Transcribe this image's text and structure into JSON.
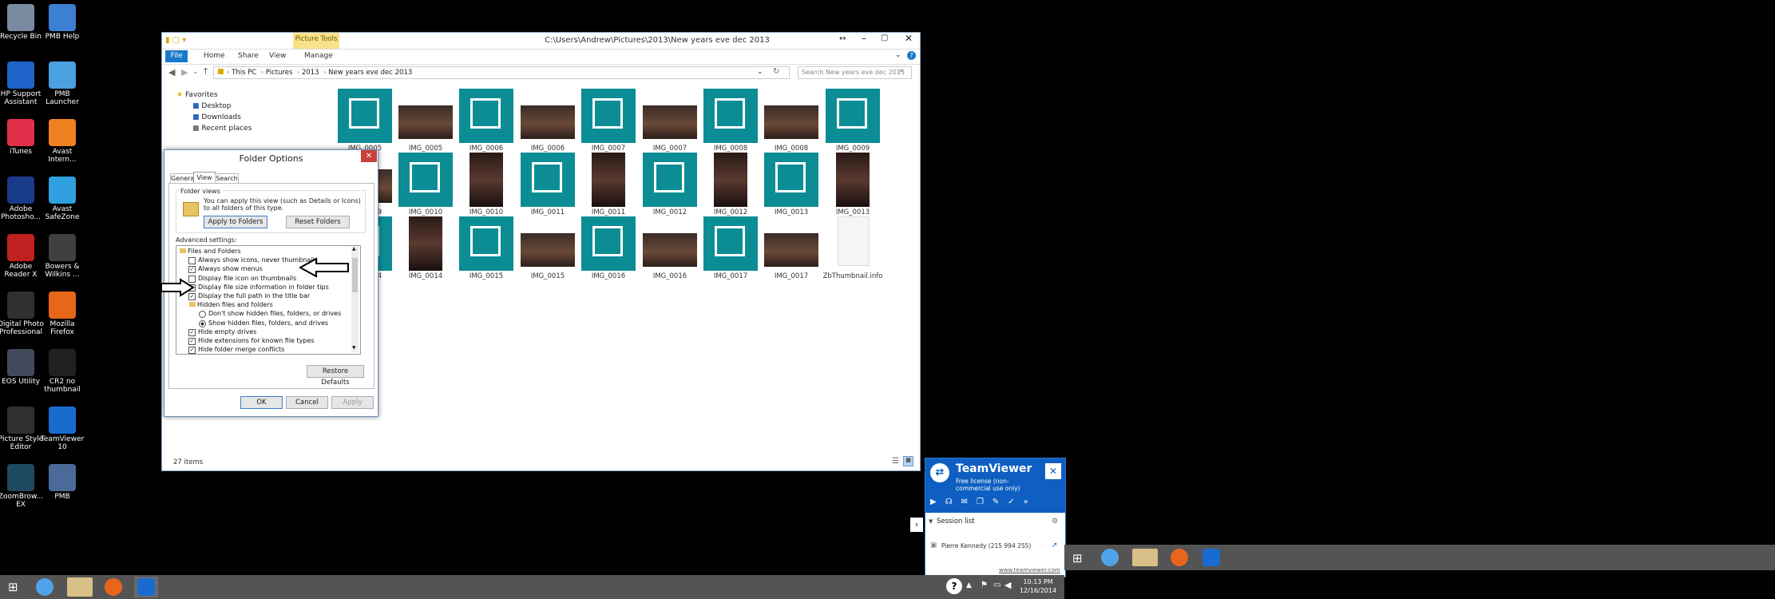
{
  "desktop_icons": [
    {
      "label": "Recycle Bin"
    },
    {
      "label": "PMB Help"
    },
    {
      "label": "HP Support Assistant"
    },
    {
      "label": "PMB Launcher"
    },
    {
      "label": "iTunes"
    },
    {
      "label": "Avast Intern..."
    },
    {
      "label": "Adobe Photosho..."
    },
    {
      "label": "Avast SafeZone"
    },
    {
      "label": "Adobe Reader X"
    },
    {
      "label": "Bowers & Wilkins ..."
    },
    {
      "label": "Digital Photo Professional"
    },
    {
      "label": "Mozilla Firefox"
    },
    {
      "label": "EOS Utility"
    },
    {
      "label": "CR2 no thumbnail"
    },
    {
      "label": "Picture Style Editor"
    },
    {
      "label": "TeamViewer 10"
    },
    {
      "label": "ZoomBrow... EX"
    },
    {
      "label": "PMB"
    }
  ],
  "explorer": {
    "title": "C:\\Users\\Andrew\\Pictures\\2013\\New years eve dec 2013",
    "contextual_tab": "Picture Tools",
    "ribbon_tabs": [
      "File",
      "Home",
      "Share",
      "View",
      "Manage"
    ],
    "breadcrumb": [
      "This PC",
      "Pictures",
      "2013",
      "New years eve dec 2013"
    ],
    "search_placeholder": "Search New years eve dec 2013",
    "nav": {
      "favorites": "Favorites",
      "items": [
        "Desktop",
        "Downloads",
        "Recent places"
      ]
    },
    "files": [
      "IMG_0005",
      "IMG_0005",
      "IMG_0006",
      "IMG_0006",
      "IMG_0007",
      "IMG_0007",
      "IMG_0008",
      "IMG_0008",
      "IMG_0009",
      "IMG_0009",
      "IMG_0010",
      "IMG_0010",
      "IMG_0011",
      "IMG_0011",
      "IMG_0012",
      "IMG_0012",
      "IMG_0013",
      "IMG_0013",
      "IMG_0014",
      "IMG_0014",
      "IMG_0015",
      "IMG_0015",
      "IMG_0016",
      "IMG_0016",
      "IMG_0017",
      "IMG_0017",
      "ZbThumbnail.info"
    ],
    "status": "27 items"
  },
  "folder_options": {
    "title": "Folder Options",
    "tabs": [
      "General",
      "View",
      "Search"
    ],
    "folder_views_label": "Folder views",
    "folder_views_text": "You can apply this view (such as Details or Icons) to all folders of this type.",
    "apply_to_folders": "Apply to Folders",
    "reset_folders": "Reset Folders",
    "advanced_label": "Advanced settings:",
    "tree": [
      {
        "type": "folder",
        "label": "Files and Folders"
      },
      {
        "type": "check",
        "checked": false,
        "label": "Always show icons, never thumbnails"
      },
      {
        "type": "check",
        "checked": true,
        "label": "Always show menus"
      },
      {
        "type": "check",
        "checked": false,
        "label": "Display file icon on thumbnails"
      },
      {
        "type": "check",
        "checked": true,
        "label": "Display file size information in folder tips"
      },
      {
        "type": "check",
        "checked": true,
        "label": "Display the full path in the title bar"
      },
      {
        "type": "folder",
        "label": "Hidden files and folders"
      },
      {
        "type": "radio",
        "checked": false,
        "label": "Don't show hidden files, folders, or drives"
      },
      {
        "type": "radio",
        "checked": true,
        "label": "Show hidden files, folders, and drives"
      },
      {
        "type": "check",
        "checked": true,
        "label": "Hide empty drives"
      },
      {
        "type": "check",
        "checked": true,
        "label": "Hide extensions for known file types"
      },
      {
        "type": "check",
        "checked": true,
        "label": "Hide folder merge conflicts"
      }
    ],
    "restore_defaults": "Restore Defaults",
    "ok": "OK",
    "cancel": "Cancel",
    "apply": "Apply"
  },
  "teamviewer": {
    "title": "TeamViewer",
    "license": "Free license (non-commercial use only)",
    "session_list": "Session list",
    "partner": "Pierre Kennedy (215 994 255)",
    "url": "www.teamviewer.com"
  },
  "clock": {
    "time": "10:13 PM",
    "date": "12/16/2014"
  },
  "colors": {
    "teal": "#0c8d95",
    "tv_blue": "#0e5fc1",
    "accent": "#1979ca"
  }
}
